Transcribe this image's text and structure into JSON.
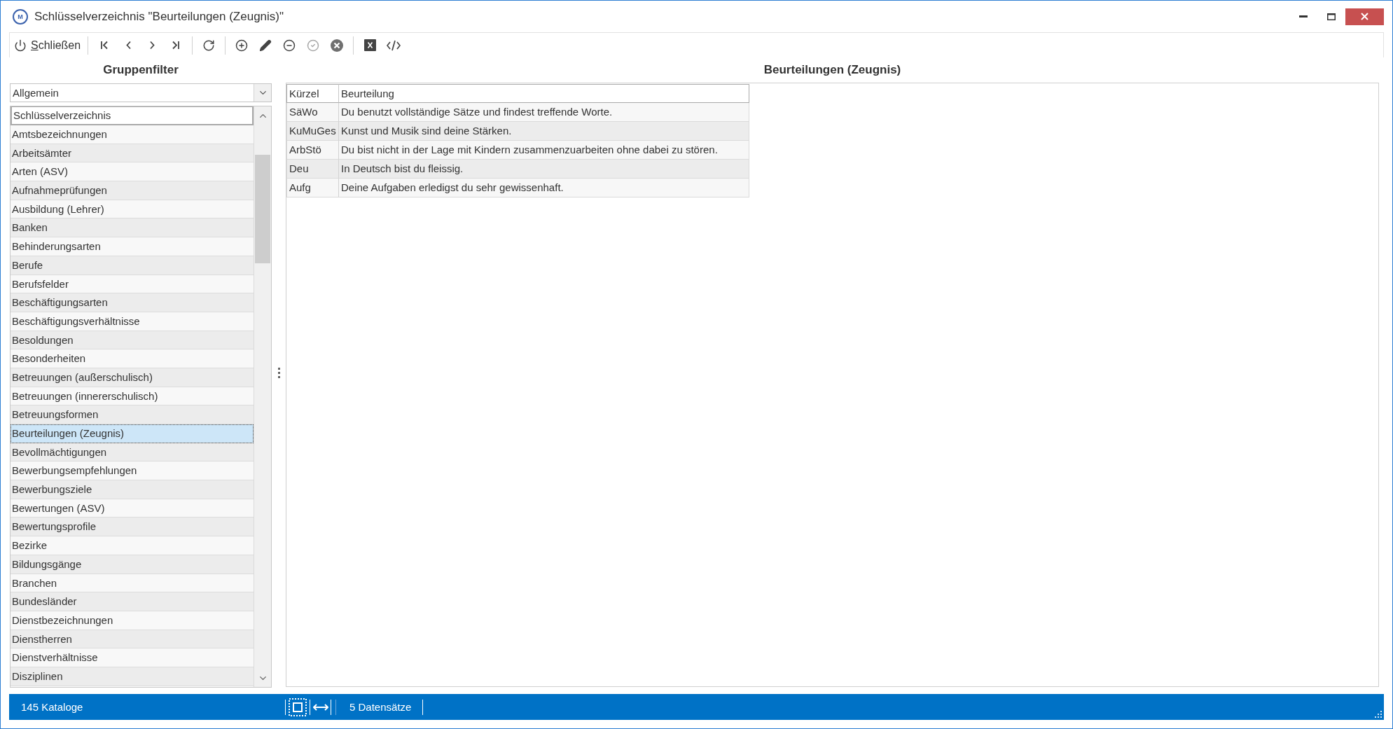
{
  "window": {
    "logo_text": "M",
    "title": "Schlüsselverzeichnis \"Beurteilungen (Zeugnis)\""
  },
  "toolbar": {
    "items": [
      {
        "kind": "labeled",
        "label": "Schließen",
        "disabled": false
      },
      {
        "kind": "separator"
      },
      {
        "kind": "icon",
        "disabled": false
      },
      {
        "kind": "icon",
        "disabled": false
      },
      {
        "kind": "icon",
        "disabled": false
      },
      {
        "kind": "icon",
        "disabled": false
      },
      {
        "kind": "separator"
      },
      {
        "kind": "icon",
        "disabled": false
      },
      {
        "kind": "separator"
      },
      {
        "kind": "icon",
        "disabled": false
      },
      {
        "kind": "icon",
        "disabled": false
      },
      {
        "kind": "icon",
        "disabled": false
      },
      {
        "kind": "icon",
        "disabled": true
      },
      {
        "kind": "icon",
        "disabled": false
      },
      {
        "kind": "separator"
      },
      {
        "kind": "icon",
        "disabled": false
      },
      {
        "kind": "icon",
        "disabled": false
      }
    ]
  },
  "group_filter": {
    "title": "Gruppenfilter",
    "dropdown": {
      "value": "Allgemein"
    },
    "list": {
      "column": "Schlüsselverzeichnis",
      "items": [
        {
          "label": "Amtsbezeichnungen",
          "selected": false
        },
        {
          "label": "Arbeitsämter",
          "selected": false
        },
        {
          "label": "Arten (ASV)",
          "selected": false
        },
        {
          "label": "Aufnahmeprüfungen",
          "selected": false
        },
        {
          "label": "Ausbildung (Lehrer)",
          "selected": false
        },
        {
          "label": "Banken",
          "selected": false
        },
        {
          "label": "Behinderungsarten",
          "selected": false
        },
        {
          "label": "Berufe",
          "selected": false
        },
        {
          "label": "Berufsfelder",
          "selected": false
        },
        {
          "label": "Beschäftigungsarten",
          "selected": false
        },
        {
          "label": "Beschäftigungsverhältnisse",
          "selected": false
        },
        {
          "label": "Besoldungen",
          "selected": false
        },
        {
          "label": "Besonderheiten",
          "selected": false
        },
        {
          "label": "Betreuungen (außerschulisch)",
          "selected": false
        },
        {
          "label": "Betreuungen (innererschulisch)",
          "selected": false
        },
        {
          "label": "Betreuungsformen",
          "selected": false
        },
        {
          "label": "Beurteilungen (Zeugnis)",
          "selected": true
        },
        {
          "label": "Bevollmächtigungen",
          "selected": false
        },
        {
          "label": "Bewerbungsempfehlungen",
          "selected": false
        },
        {
          "label": "Bewerbungsziele",
          "selected": false
        },
        {
          "label": "Bewertungen (ASV)",
          "selected": false
        },
        {
          "label": "Bewertungsprofile",
          "selected": false
        },
        {
          "label": "Bezirke",
          "selected": false
        },
        {
          "label": "Bildungsgänge",
          "selected": false
        },
        {
          "label": "Branchen",
          "selected": false
        },
        {
          "label": "Bundesländer",
          "selected": false
        },
        {
          "label": "Dienstbezeichnungen",
          "selected": false
        },
        {
          "label": "Dienstherren",
          "selected": false
        },
        {
          "label": "Dienstverhältnisse",
          "selected": false
        },
        {
          "label": "Disziplinen",
          "selected": false
        }
      ]
    }
  },
  "catalog": {
    "title": "Beurteilungen (Zeugnis)",
    "table": {
      "columns": [
        "Kürzel",
        "Beurteilung"
      ],
      "rows": [
        {
          "cells": [
            "SäWo",
            "Du benutzt vollständige Sätze und findest treffende Worte."
          ]
        },
        {
          "cells": [
            "KuMuGes",
            "Kunst und Musik sind deine Stärken."
          ]
        },
        {
          "cells": [
            "ArbStö",
            "Du bist nicht in der Lage mit Kindern zusammenzuarbeiten ohne dabei zu stören."
          ]
        },
        {
          "cells": [
            "Deu",
            "In Deutsch bist du fleissig."
          ]
        },
        {
          "cells": [
            "Aufg",
            "Deine Aufgaben erledigst du sehr gewissenhaft."
          ]
        }
      ]
    }
  },
  "status_bar": {
    "catalog_count": "145 Kataloge",
    "record_count": "5 Datensätze"
  }
}
